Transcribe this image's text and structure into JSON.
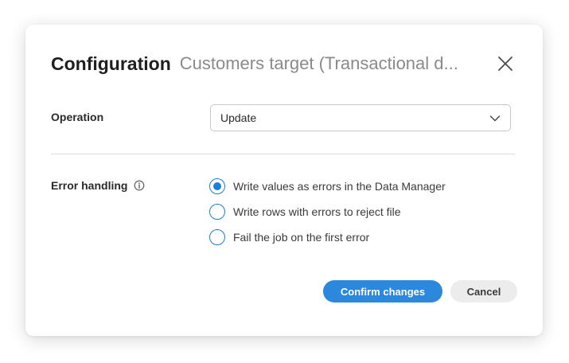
{
  "dialog": {
    "title": "Configuration",
    "subtitle": "Customers target (Transactional d..."
  },
  "operation": {
    "label": "Operation",
    "selected_value": "Update"
  },
  "error_handling": {
    "label": "Error handling",
    "options": [
      {
        "label": "Write values as errors in the Data Manager",
        "selected": true
      },
      {
        "label": "Write rows with errors to reject file",
        "selected": false
      },
      {
        "label": "Fail the job on the first error",
        "selected": false
      }
    ]
  },
  "footer": {
    "confirm_label": "Confirm changes",
    "cancel_label": "Cancel"
  },
  "colors": {
    "accent": "#2b88dc",
    "radio": "#1e7fd6",
    "secondary_button": "#ececec"
  },
  "icons": {
    "close": "close-icon",
    "info": "info-icon",
    "dropdown": "chevron-down-icon"
  }
}
